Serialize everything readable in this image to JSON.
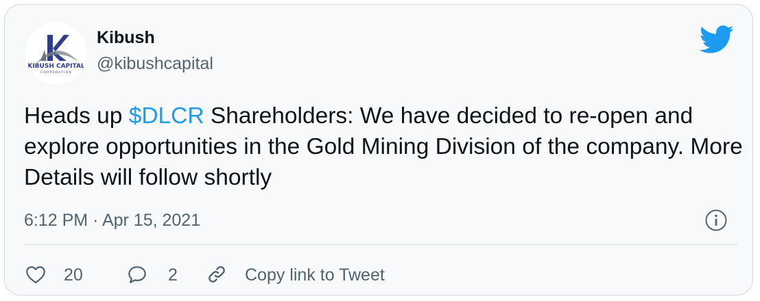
{
  "author": {
    "name": "Kibush",
    "handle": "@kibushcapital",
    "avatar_text": "KIBUSH CAPITAL",
    "avatar_subtext": "CORPORATION"
  },
  "tweet": {
    "text_before": "Heads up ",
    "cashtag": "$DLCR",
    "text_after": " Shareholders: We have decided to re-open and explore opportunities in the Gold Mining Division of the company. More Details will follow shortly",
    "timestamp": "6:12 PM · Apr 15, 2021"
  },
  "actions": {
    "likes": "20",
    "replies": "2",
    "copy_link_label": "Copy link to Tweet"
  },
  "icons": [
    "twitter-bird-icon",
    "info-icon",
    "heart-icon",
    "reply-icon",
    "link-icon"
  ],
  "colors": {
    "accent": "#1d9bf0",
    "text": "#0f1419",
    "muted": "#536471",
    "border": "#cfd9de",
    "card_bg": "#f7f9fa"
  }
}
